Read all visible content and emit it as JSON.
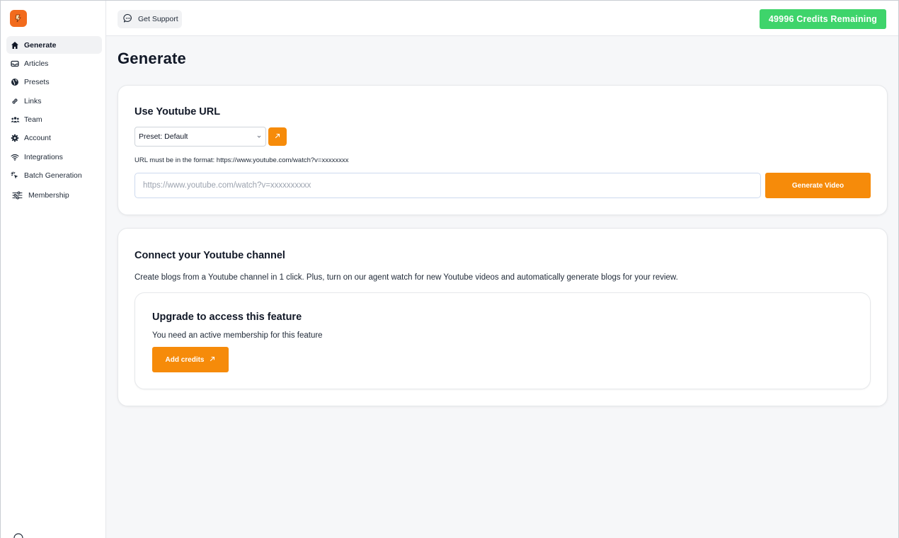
{
  "sidebar": {
    "items": [
      {
        "label": "Generate",
        "icon": "home-icon",
        "active": true
      },
      {
        "label": "Articles",
        "icon": "inbox-icon"
      },
      {
        "label": "Presets",
        "icon": "globe-icon"
      },
      {
        "label": "Links",
        "icon": "link-icon"
      },
      {
        "label": "Team",
        "icon": "users-icon"
      },
      {
        "label": "Account",
        "icon": "gear-icon"
      },
      {
        "label": "Integrations",
        "icon": "wifi-icon"
      },
      {
        "label": "Batch Generation",
        "icon": "cursor-click-icon"
      },
      {
        "label": "Membership",
        "icon": "sliders-icon"
      }
    ]
  },
  "header": {
    "support_label": "Get Support",
    "credits_label": "49996 Credits Remaining"
  },
  "page": {
    "title": "Generate"
  },
  "youtube_url": {
    "title": "Use Youtube URL",
    "preset_value": "Preset: Default",
    "format_note": "URL must be in the format: https://www.youtube.com/watch?v=xxxxxxxx",
    "url_placeholder": "https://www.youtube.com/watch?v=xxxxxxxxxx",
    "generate_label": "Generate Video"
  },
  "channel": {
    "title": "Connect your Youtube channel",
    "description": "Create blogs from a Youtube channel in 1 click. Plus, turn on our agent watch for new Youtube videos and automatically generate blogs for your review.",
    "upgrade_title": "Upgrade to access this feature",
    "upgrade_description": "You need an active membership for this feature",
    "add_credits_label": "Add credits"
  },
  "colors": {
    "accent": "#f68b0a",
    "credits_green": "#3ed46b",
    "logo_orange": "#f26b1d"
  }
}
